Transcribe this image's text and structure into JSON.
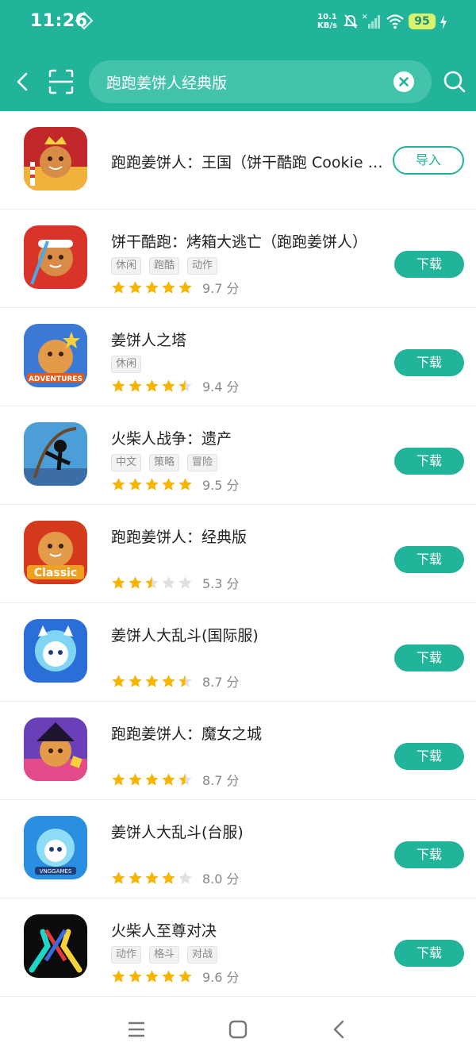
{
  "status": {
    "time": "11:26",
    "speed_value": "10.1",
    "speed_unit": "KB/s",
    "battery": "95"
  },
  "search": {
    "query": "跑跑姜饼人经典版"
  },
  "apps": [
    {
      "name": "跑跑姜饼人：王国（饼干酷跑 Cookie Run: Kingdom）",
      "tags": [],
      "rating": null,
      "score": "",
      "action": "导入",
      "icon": "cookie-kingdom-icon"
    },
    {
      "name": "饼干酷跑：烤箱大逃亡（跑跑姜饼人）",
      "tags": [
        "休闲",
        "跑酷",
        "动作"
      ],
      "rating": 5,
      "score": "9.7 分",
      "action": "下载",
      "icon": "cookie-ovenbreak-icon"
    },
    {
      "name": "姜饼人之塔",
      "tags": [
        "休闲"
      ],
      "rating": 4.5,
      "score": "9.4 分",
      "action": "下载",
      "icon": "cookie-tower-icon"
    },
    {
      "name": "火柴人战争：遗产",
      "tags": [
        "中文",
        "策略",
        "冒险"
      ],
      "rating": 5,
      "score": "9.5 分",
      "action": "下载",
      "icon": "stick-war-icon"
    },
    {
      "name": "跑跑姜饼人：经典版",
      "tags": [],
      "rating": 2.5,
      "score": "5.3 分",
      "action": "下载",
      "icon": "cookie-classic-icon"
    },
    {
      "name": "姜饼人大乱斗(国际服)",
      "tags": [],
      "rating": 4.5,
      "score": "8.7 分",
      "action": "下载",
      "icon": "cookie-brawl-intl-icon"
    },
    {
      "name": "跑跑姜饼人：魔女之城",
      "tags": [],
      "rating": 4.5,
      "score": "8.7 分",
      "action": "下载",
      "icon": "cookie-witch-icon"
    },
    {
      "name": "姜饼人大乱斗(台服)",
      "tags": [],
      "rating": 4,
      "score": "8.0 分",
      "action": "下载",
      "icon": "cookie-brawl-tw-icon"
    },
    {
      "name": "火柴人至尊对决",
      "tags": [
        "动作",
        "格斗",
        "对战"
      ],
      "rating": 5,
      "score": "9.6 分",
      "action": "下载",
      "icon": "stickman-supreme-icon"
    }
  ],
  "colors": {
    "accent": "#22b49a",
    "star": "#f7b500",
    "star_empty": "#e0e0e0"
  }
}
